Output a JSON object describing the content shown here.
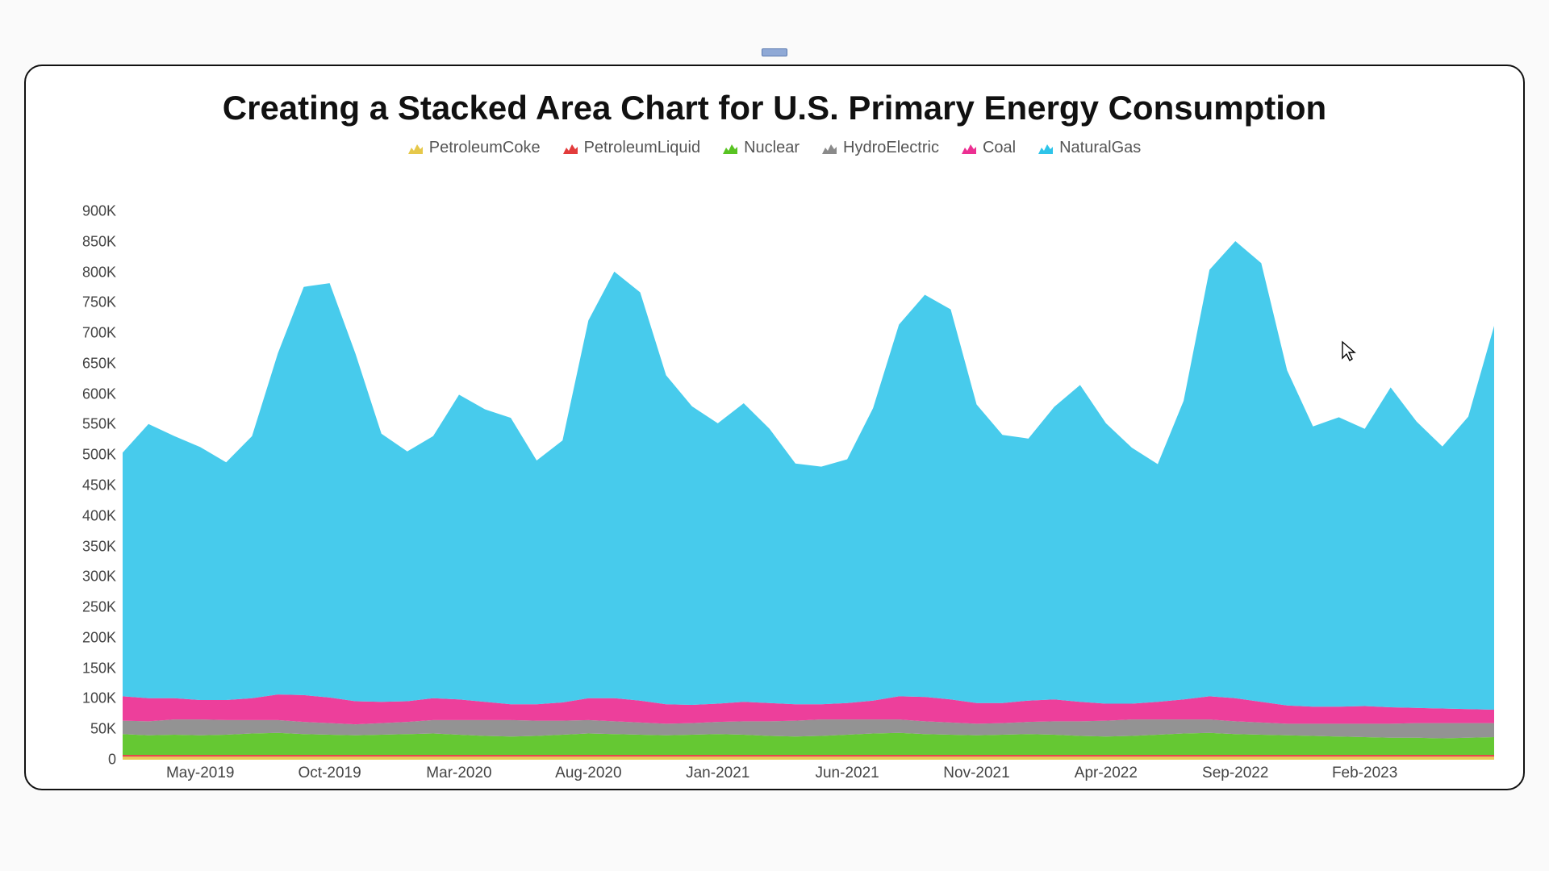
{
  "chart_data": {
    "type": "area",
    "title": "Creating a Stacked Area Chart for U.S. Primary Energy Consumption",
    "xlabel": "",
    "ylabel": "",
    "ylim": [
      0,
      900000
    ],
    "y_ticks": [
      0,
      50000,
      100000,
      150000,
      200000,
      250000,
      300000,
      350000,
      400000,
      450000,
      500000,
      550000,
      600000,
      650000,
      700000,
      750000,
      800000,
      850000,
      900000
    ],
    "y_tick_labels": [
      "0",
      "50K",
      "100K",
      "150K",
      "200K",
      "250K",
      "300K",
      "350K",
      "400K",
      "450K",
      "500K",
      "550K",
      "600K",
      "650K",
      "700K",
      "750K",
      "800K",
      "850K",
      "900K"
    ],
    "x_tick_labels": [
      "May-2019",
      "Oct-2019",
      "Mar-2020",
      "Aug-2020",
      "Jan-2021",
      "Jun-2021",
      "Nov-2021",
      "Apr-2022",
      "Sep-2022",
      "Feb-2023"
    ],
    "x_tick_indices": [
      3,
      8,
      13,
      18,
      23,
      28,
      33,
      38,
      43,
      48
    ],
    "legend": [
      {
        "name": "PetroleumCoke",
        "color": "#e6c84a"
      },
      {
        "name": "PetroleumLiquid",
        "color": "#e23b3b"
      },
      {
        "name": "Nuclear",
        "color": "#58c322"
      },
      {
        "name": "HydroElectric",
        "color": "#8a8a8a"
      },
      {
        "name": "Coal",
        "color": "#ec2f92"
      },
      {
        "name": "NaturalGas",
        "color": "#2ec4e9"
      }
    ],
    "n_points": 54,
    "stacked_top": {
      "PetroleumCoke": 5000,
      "PetroleumLiquid": 8000
    },
    "series": [
      {
        "name": "PetroleumCoke",
        "color": "#e6c84a",
        "values": [
          5000,
          5000,
          5000,
          5000,
          5000,
          5000,
          5000,
          5000,
          5000,
          5000,
          5000,
          5000,
          5000,
          5000,
          5000,
          5000,
          5000,
          5000,
          5000,
          5000,
          5000,
          5000,
          5000,
          5000,
          5000,
          5000,
          5000,
          5000,
          5000,
          5000,
          5000,
          5000,
          5000,
          5000,
          5000,
          5000,
          5000,
          5000,
          5000,
          5000,
          5000,
          5000,
          5000,
          5000,
          5000,
          5000,
          5000,
          5000,
          5000,
          5000,
          5000,
          5000,
          5000,
          5000
        ]
      },
      {
        "name": "PetroleumLiquid",
        "color": "#e23b3b",
        "values": [
          3000,
          3000,
          3000,
          3000,
          3000,
          3000,
          3000,
          3000,
          3000,
          3000,
          3000,
          3000,
          3000,
          3000,
          3000,
          3000,
          3000,
          3000,
          3000,
          3000,
          3000,
          3000,
          3000,
          3000,
          3000,
          3000,
          3000,
          3000,
          3000,
          3000,
          3000,
          3000,
          3000,
          3000,
          3000,
          3000,
          3000,
          3000,
          3000,
          3000,
          3000,
          3000,
          3000,
          3000,
          3000,
          3000,
          3000,
          3000,
          3000,
          3000,
          3000,
          3000,
          3000,
          3000
        ]
      },
      {
        "name": "Nuclear",
        "color": "#58c322",
        "values": [
          34000,
          32000,
          33000,
          32000,
          33000,
          35000,
          36000,
          34000,
          33000,
          32000,
          33000,
          34000,
          35000,
          33000,
          31000,
          30000,
          31000,
          33000,
          35000,
          34000,
          33000,
          32000,
          33000,
          34000,
          33000,
          31000,
          30000,
          31000,
          33000,
          35000,
          36000,
          34000,
          33000,
          32000,
          33000,
          34000,
          33000,
          31000,
          30000,
          31000,
          33000,
          35000,
          36000,
          34000,
          33000,
          32000,
          31000,
          30000,
          29000,
          28000,
          28000,
          27000,
          28000,
          29000
        ]
      },
      {
        "name": "HydroElectric",
        "color": "#8a8a8a",
        "values": [
          22000,
          23000,
          25000,
          26000,
          24000,
          22000,
          21000,
          20000,
          19000,
          18000,
          19000,
          20000,
          22000,
          24000,
          26000,
          27000,
          25000,
          23000,
          22000,
          21000,
          20000,
          19000,
          19000,
          20000,
          22000,
          24000,
          26000,
          27000,
          25000,
          23000,
          22000,
          21000,
          20000,
          19000,
          19000,
          20000,
          22000,
          24000,
          26000,
          27000,
          25000,
          23000,
          22000,
          21000,
          20000,
          19000,
          20000,
          21000,
          22000,
          23000,
          24000,
          25000,
          24000,
          23000
        ]
      },
      {
        "name": "Coal",
        "color": "#ec2f92",
        "values": [
          40000,
          38000,
          35000,
          32000,
          33000,
          36000,
          42000,
          44000,
          42000,
          38000,
          35000,
          34000,
          36000,
          34000,
          30000,
          26000,
          27000,
          30000,
          36000,
          38000,
          36000,
          32000,
          30000,
          30000,
          32000,
          30000,
          27000,
          25000,
          27000,
          31000,
          38000,
          40000,
          38000,
          34000,
          33000,
          35000,
          36000,
          32000,
          28000,
          26000,
          29000,
          33000,
          38000,
          38000,
          34000,
          30000,
          28000,
          28000,
          29000,
          27000,
          25000,
          24000,
          23000,
          22000
        ]
      },
      {
        "name": "NaturalGas",
        "color": "#2ec4e9",
        "values": [
          400000,
          450000,
          430000,
          415000,
          390000,
          430000,
          560000,
          670000,
          680000,
          570000,
          440000,
          410000,
          430000,
          500000,
          480000,
          470000,
          400000,
          430000,
          620000,
          700000,
          670000,
          540000,
          490000,
          460000,
          490000,
          450000,
          395000,
          390000,
          400000,
          480000,
          610000,
          660000,
          640000,
          490000,
          440000,
          430000,
          480000,
          520000,
          460000,
          420000,
          390000,
          490000,
          700000,
          750000,
          720000,
          550000,
          460000,
          475000,
          455000,
          525000,
          470000,
          430000,
          480000,
          630000
        ]
      }
    ]
  }
}
